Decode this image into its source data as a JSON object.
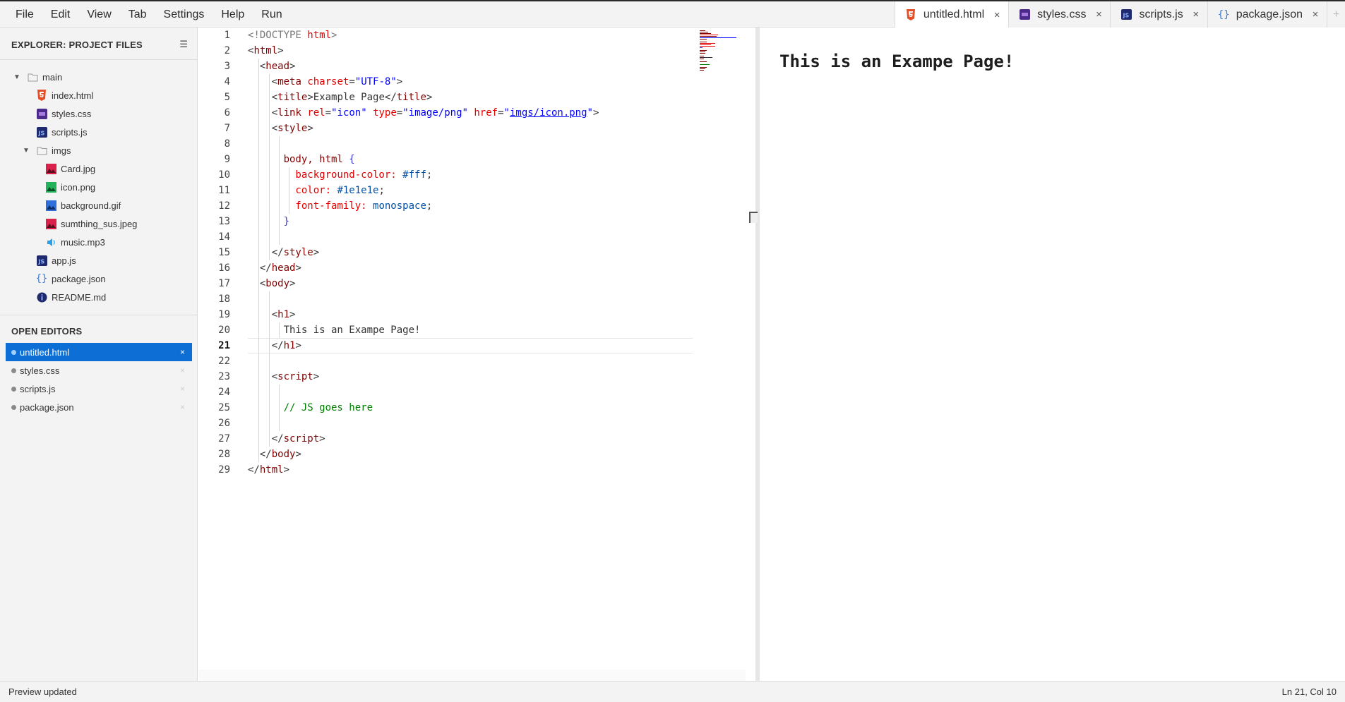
{
  "menu": [
    "File",
    "Edit",
    "View",
    "Tab",
    "Settings",
    "Help",
    "Run"
  ],
  "tabs": [
    {
      "label": "untitled.html",
      "icon": "html5-icon",
      "active": true
    },
    {
      "label": "styles.css",
      "icon": "css-file-icon",
      "active": false
    },
    {
      "label": "scripts.js",
      "icon": "js-file-icon",
      "active": false
    },
    {
      "label": "package.json",
      "icon": "json-braces-icon",
      "active": false
    }
  ],
  "tab_close": "×",
  "tab_add": "+",
  "explorer": {
    "title": "EXPLORER: PROJECT FILES",
    "menu_icon": "☰",
    "tree": [
      {
        "label": "main",
        "type": "folder",
        "depth": 0,
        "open": true
      },
      {
        "label": "index.html",
        "type": "html",
        "depth": 1
      },
      {
        "label": "styles.css",
        "type": "css",
        "depth": 1
      },
      {
        "label": "scripts.js",
        "type": "js",
        "depth": 1
      },
      {
        "label": "imgs",
        "type": "folder",
        "depth": 1,
        "open": true
      },
      {
        "label": "Card.jpg",
        "type": "img-red",
        "depth": 2
      },
      {
        "label": "icon.png",
        "type": "img-green",
        "depth": 2
      },
      {
        "label": "background.gif",
        "type": "img-blue",
        "depth": 2
      },
      {
        "label": "sumthing_sus.jpeg",
        "type": "img-red",
        "depth": 2
      },
      {
        "label": "music.mp3",
        "type": "audio",
        "depth": 2
      },
      {
        "label": "app.js",
        "type": "js",
        "depth": 1
      },
      {
        "label": "package.json",
        "type": "json",
        "depth": 1
      },
      {
        "label": "README.md",
        "type": "info",
        "depth": 1
      }
    ]
  },
  "open_editors": {
    "title": "OPEN EDITORS",
    "items": [
      {
        "label": "untitled.html",
        "active": true
      },
      {
        "label": "styles.css",
        "active": false
      },
      {
        "label": "scripts.js",
        "active": false
      },
      {
        "label": "package.json",
        "active": false
      }
    ],
    "close": "×"
  },
  "editor": {
    "current_line": 21,
    "lines": [
      [
        {
          "t": "<!DOCTYPE ",
          "c": "t-gray"
        },
        {
          "t": "html",
          "c": "t-attr"
        },
        {
          "t": ">",
          "c": "t-gray"
        }
      ],
      [
        {
          "t": "<",
          "c": "t-punc"
        },
        {
          "t": "html",
          "c": "t-tag"
        },
        {
          "t": ">",
          "c": "t-punc"
        }
      ],
      [
        {
          "t": "  <",
          "c": "t-punc"
        },
        {
          "t": "head",
          "c": "t-tag"
        },
        {
          "t": ">",
          "c": "t-punc"
        }
      ],
      [
        {
          "t": "    <",
          "c": "t-punc"
        },
        {
          "t": "meta ",
          "c": "t-tag"
        },
        {
          "t": "charset",
          "c": "t-attr"
        },
        {
          "t": "=",
          "c": "t-punc"
        },
        {
          "t": "\"UTF-8\"",
          "c": "t-str"
        },
        {
          "t": ">",
          "c": "t-punc"
        }
      ],
      [
        {
          "t": "    <",
          "c": "t-punc"
        },
        {
          "t": "title",
          "c": "t-tag"
        },
        {
          "t": ">Example Page</",
          "c": "t-punc"
        },
        {
          "t": "title",
          "c": "t-tag"
        },
        {
          "t": ">",
          "c": "t-punc"
        }
      ],
      [
        {
          "t": "    <",
          "c": "t-punc"
        },
        {
          "t": "link ",
          "c": "t-tag"
        },
        {
          "t": "rel",
          "c": "t-attr"
        },
        {
          "t": "=",
          "c": "t-punc"
        },
        {
          "t": "\"icon\" ",
          "c": "t-str"
        },
        {
          "t": "type",
          "c": "t-attr"
        },
        {
          "t": "=",
          "c": "t-punc"
        },
        {
          "t": "\"image/png\" ",
          "c": "t-str"
        },
        {
          "t": "href",
          "c": "t-attr"
        },
        {
          "t": "=",
          "c": "t-punc"
        },
        {
          "t": "\"",
          "c": "t-str"
        },
        {
          "t": "imgs/icon.png",
          "c": "t-link"
        },
        {
          "t": "\"",
          "c": "t-str"
        },
        {
          "t": ">",
          "c": "t-punc"
        }
      ],
      [
        {
          "t": "    <",
          "c": "t-punc"
        },
        {
          "t": "style",
          "c": "t-tag"
        },
        {
          "t": ">",
          "c": "t-punc"
        }
      ],
      [],
      [
        {
          "t": "      body, html ",
          "c": "t-sel"
        },
        {
          "t": "{",
          "c": "t-brace"
        }
      ],
      [
        {
          "t": "        background-color: ",
          "c": "t-prop"
        },
        {
          "t": "#fff",
          "c": "t-val"
        },
        {
          "t": ";",
          "c": "t-punc"
        }
      ],
      [
        {
          "t": "        color: ",
          "c": "t-prop"
        },
        {
          "t": "#1e1e1e",
          "c": "t-val"
        },
        {
          "t": ";",
          "c": "t-punc"
        }
      ],
      [
        {
          "t": "        font-family: ",
          "c": "t-prop"
        },
        {
          "t": "monospace",
          "c": "t-val"
        },
        {
          "t": ";",
          "c": "t-punc"
        }
      ],
      [
        {
          "t": "      }",
          "c": "t-brace"
        }
      ],
      [],
      [
        {
          "t": "    </",
          "c": "t-punc"
        },
        {
          "t": "style",
          "c": "t-tag"
        },
        {
          "t": ">",
          "c": "t-punc"
        }
      ],
      [
        {
          "t": "  </",
          "c": "t-punc"
        },
        {
          "t": "head",
          "c": "t-tag"
        },
        {
          "t": ">",
          "c": "t-punc"
        }
      ],
      [
        {
          "t": "  <",
          "c": "t-punc"
        },
        {
          "t": "body",
          "c": "t-tag"
        },
        {
          "t": ">",
          "c": "t-punc"
        }
      ],
      [],
      [
        {
          "t": "    <",
          "c": "t-punc"
        },
        {
          "t": "h1",
          "c": "t-tag"
        },
        {
          "t": ">",
          "c": "t-punc"
        }
      ],
      [
        {
          "t": "      This is an Exampe Page!",
          "c": "t-punc"
        }
      ],
      [
        {
          "t": "    <",
          "c": "t-punc"
        },
        {
          "t": "/",
          "c": "t-punc"
        },
        {
          "t": "h1",
          "c": "t-tag"
        },
        {
          "t": ">",
          "c": "t-punc"
        }
      ],
      [],
      [
        {
          "t": "    <",
          "c": "t-punc"
        },
        {
          "t": "script",
          "c": "t-tag"
        },
        {
          "t": ">",
          "c": "t-punc"
        }
      ],
      [],
      [
        {
          "t": "      // JS goes here",
          "c": "t-comment"
        }
      ],
      [],
      [
        {
          "t": "    </",
          "c": "t-punc"
        },
        {
          "t": "script",
          "c": "t-tag"
        },
        {
          "t": ">",
          "c": "t-punc"
        }
      ],
      [
        {
          "t": "  </",
          "c": "t-punc"
        },
        {
          "t": "body",
          "c": "t-tag"
        },
        {
          "t": ">",
          "c": "t-punc"
        }
      ],
      [
        {
          "t": "</",
          "c": "t-punc"
        },
        {
          "t": "html",
          "c": "t-tag"
        },
        {
          "t": ">",
          "c": "t-punc"
        }
      ]
    ]
  },
  "preview": {
    "heading": "This is an Exampe Page!"
  },
  "status": {
    "left": "Preview updated",
    "right": "Ln 21, Col 10"
  },
  "colors": {
    "accent": "#0d6fd6",
    "html5": "#e44d26",
    "css": "#663399",
    "js": "#1f2a6e",
    "json": "#3a7bd5"
  }
}
